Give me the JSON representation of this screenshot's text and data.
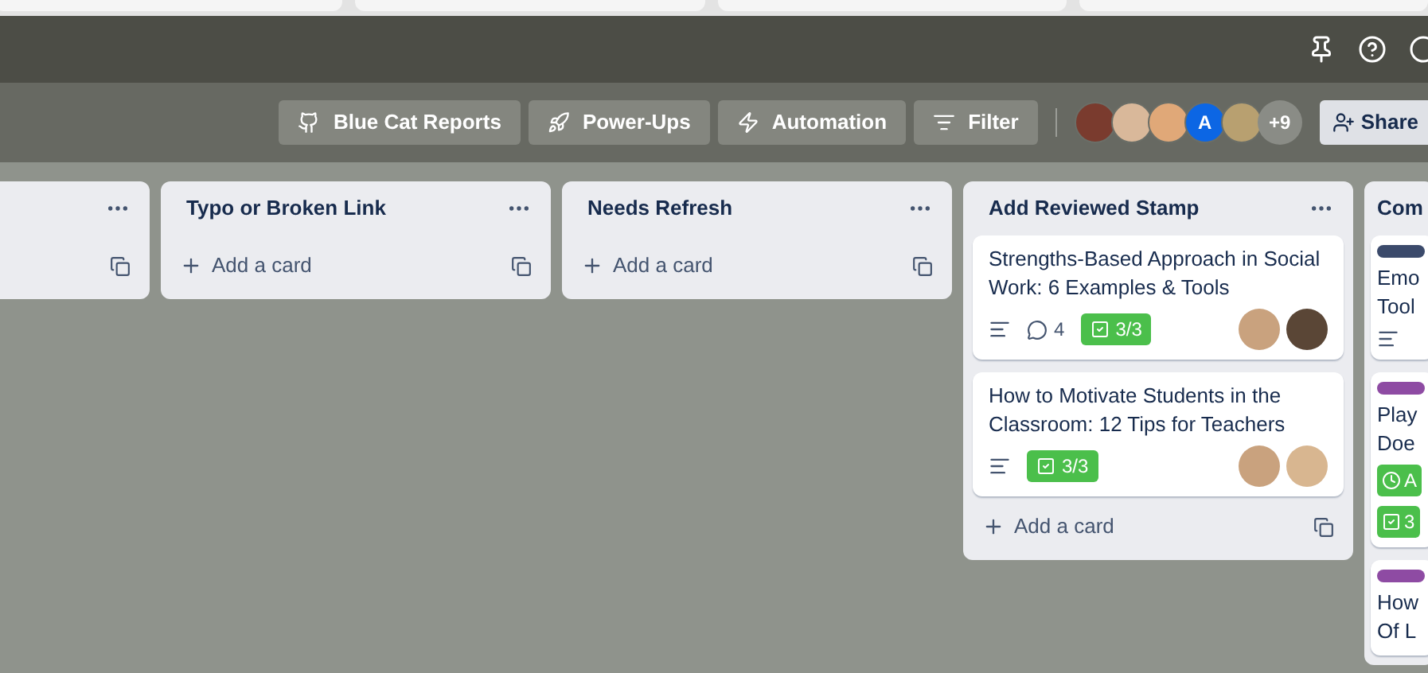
{
  "board_bar": {
    "buttons": [
      {
        "kind": "github",
        "label": "Blue Cat Reports"
      },
      {
        "kind": "powerups",
        "label": "Power-Ups"
      },
      {
        "kind": "automation",
        "label": "Automation"
      },
      {
        "kind": "filter",
        "label": "Filter"
      }
    ],
    "members": [
      {
        "kind": "photo",
        "color": "#7a3b2e"
      },
      {
        "kind": "photo",
        "color": "#d9b89a"
      },
      {
        "kind": "photo",
        "color": "#e0a878"
      },
      {
        "kind": "initial",
        "text": "A"
      },
      {
        "kind": "photo",
        "color": "#b8a070"
      },
      {
        "kind": "count",
        "text": "+9"
      }
    ],
    "share": "Share"
  },
  "lists": [
    {
      "kind": "wide"
    },
    {
      "kind": "wide",
      "title": "Typo or Broken Link",
      "add_card": "Add a card"
    },
    {
      "kind": "wide",
      "title": "Needs Refresh",
      "add_card": "Add a card"
    },
    {
      "kind": "wide",
      "title": "Add Reviewed Stamp",
      "cards": [
        {
          "title_lines": [
            "Strengths-Based Approach in Social",
            "Work: 6 Examples & Tools"
          ],
          "badges": [
            {
              "kind": "description"
            },
            {
              "kind": "comments",
              "text": "4"
            },
            {
              "kind": "checklist",
              "text": "3/3"
            }
          ],
          "members": [
            {
              "color": "#c9a27e"
            },
            {
              "color": "#5a4636"
            }
          ]
        },
        {
          "title_lines": [
            "How to Motivate Students in the",
            "Classroom: 12 Tips for Teachers"
          ],
          "badges": [
            {
              "kind": "description"
            },
            {
              "kind": "checklist",
              "text": "3/3"
            }
          ],
          "members": [
            {
              "color": "#c9a27e"
            },
            {
              "color": "#d8b690"
            }
          ]
        }
      ],
      "add_card": "Add a card"
    },
    {
      "kind": "narrow",
      "title": "Com",
      "cards": [
        {
          "color": "#3b4a6b",
          "title_lines": [
            "Emo",
            "Tool"
          ],
          "badges": [
            {
              "kind": "description"
            }
          ]
        },
        {
          "color": "#8e4ba3",
          "title_lines": [
            "Play",
            "Doe"
          ],
          "badges": [
            {
              "kind": "due",
              "text": "A"
            },
            {
              "kind": "checklist",
              "text": "3"
            }
          ]
        },
        {
          "color": "#8e4ba3",
          "title_lines": [
            "How",
            "Of L"
          ]
        }
      ]
    }
  ]
}
